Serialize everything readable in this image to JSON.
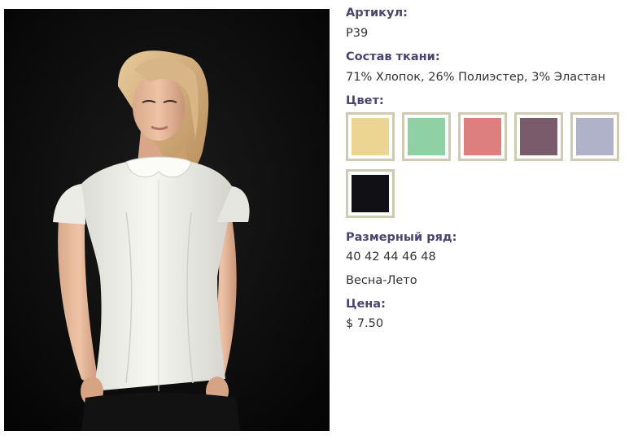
{
  "photo": {
    "alt": "",
    "background": "#0b0b0b",
    "blouse_color": "#f2f1ec"
  },
  "article": {
    "label": "Артикул:",
    "value": "P39"
  },
  "fabric": {
    "label": "Состав ткани:",
    "value": "71% Хлопок, 26% Полиэстер, 3% Эластан"
  },
  "color": {
    "label": "Цвет:",
    "swatches": [
      {
        "name": "yellow",
        "hex": "#ecd592"
      },
      {
        "name": "mint",
        "hex": "#8fd1a5"
      },
      {
        "name": "coral",
        "hex": "#dd7f7f"
      },
      {
        "name": "plum",
        "hex": "#7a5b6c"
      },
      {
        "name": "lavender-grey",
        "hex": "#b0b2ca"
      },
      {
        "name": "black",
        "hex": "#111115"
      }
    ]
  },
  "sizes": {
    "label": "Размерный ряд:",
    "value": "40 42 44 46 48"
  },
  "season": {
    "value": "Весна-Лето"
  },
  "price": {
    "label": "Цена:",
    "value": "$ 7.50"
  }
}
